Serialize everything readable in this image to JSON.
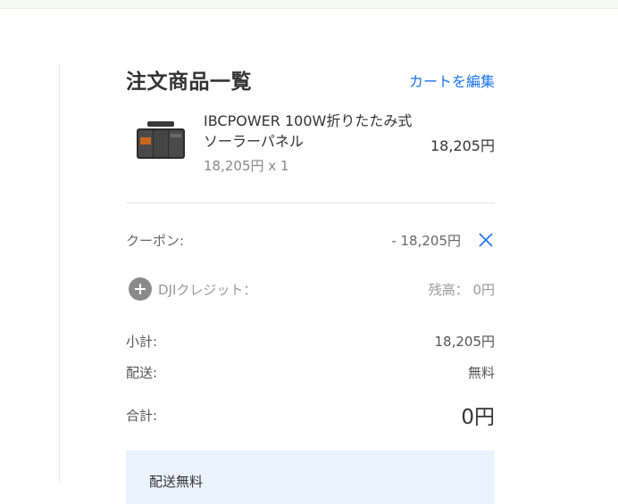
{
  "order_summary": {
    "title": "注文商品一覧",
    "edit_cart_label": "カートを編集",
    "product": {
      "name": "IBCPOWER 100W折りたたみ式ソーラーパネル",
      "unit_line": "18,205円 x 1",
      "price": "18,205円",
      "thumbnail_icon": "solar-panel-product-image"
    },
    "coupon": {
      "label": "クーポン:",
      "value": "- 18,205円",
      "remove_icon": "close-icon"
    },
    "credit": {
      "label": "DJIクレジット：",
      "value": "残高： 0円",
      "add_icon": "plus-circle-icon"
    },
    "subtotal": {
      "label": "小計:",
      "value": "18,205円"
    },
    "shipping": {
      "label": "配送:",
      "value": "無料"
    },
    "total": {
      "label": "合計:",
      "value": "0円"
    },
    "notice": {
      "text": "配送無料"
    }
  },
  "colors": {
    "link": "#1a73e8",
    "notice_bg": "#e9f2fd",
    "icon_gray": "#8a8a8a"
  }
}
